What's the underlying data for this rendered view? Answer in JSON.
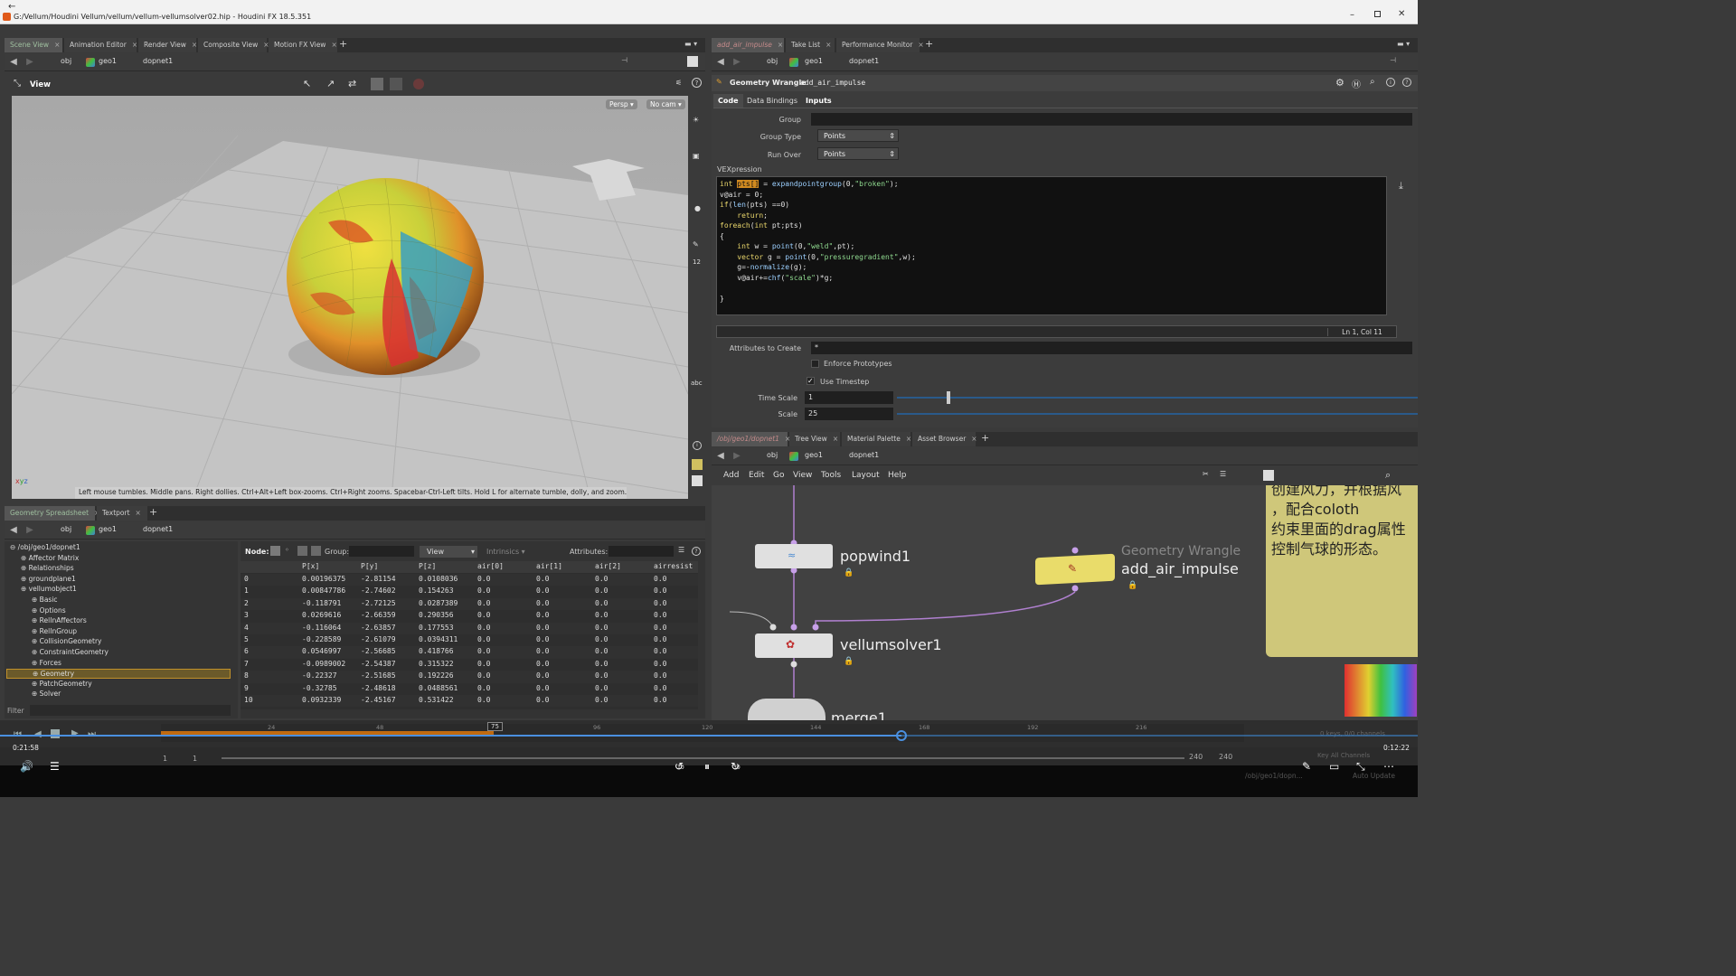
{
  "window": {
    "title": "G:/Vellum/Houdini Vellum/vellum/vellum-vellumsolver02.hip - Houdini FX 18.5.351"
  },
  "left_tabs": [
    {
      "label": "Scene View",
      "active": true
    },
    {
      "label": "Animation Editor"
    },
    {
      "label": "Render View"
    },
    {
      "label": "Composite View"
    },
    {
      "label": "Motion FX View"
    }
  ],
  "right_tabs": [
    {
      "label": "add_air_impulse",
      "active": true
    },
    {
      "label": "Take List"
    },
    {
      "label": "Performance Monitor"
    }
  ],
  "path": {
    "obj": "obj",
    "geo": "geo1",
    "dop": "dopnet1"
  },
  "viewport": {
    "title": "View",
    "persp_label": "Persp",
    "cam_label": "No cam",
    "hint": "Left mouse tumbles. Middle pans. Right dollies. Ctrl+Alt+Left box-zooms. Ctrl+Right zooms. Spacebar-Ctrl-Left tilts. Hold L for alternate tumble, dolly, and zoom."
  },
  "param": {
    "node_type": "Geometry Wrangle",
    "node_name": "add_air_impulse",
    "tabs": [
      "Code",
      "Data Bindings",
      "Inputs"
    ],
    "group_label": "Group",
    "group_type_label": "Group Type",
    "group_type_value": "Points",
    "run_over_label": "Run Over",
    "run_over_value": "Points",
    "vex_label": "VEXpression",
    "cursor_pos": "Ln 1, Col 11",
    "attrs_label": "Attributes to Create",
    "attrs_value": "*",
    "enforce_label": "Enforce Prototypes",
    "use_timestep_label": "Use Timestep",
    "time_scale_label": "Time Scale",
    "time_scale_value": "1",
    "scale_label": "Scale",
    "scale_value": "25"
  },
  "vex_lines": [
    "int pts[] = expandpointgroup(0,\"broken\");",
    "v@air = 0;",
    "if(len(pts) ==0)",
    "    return;",
    "foreach(int pt;pts)",
    "{",
    "    int w = point(0,\"weld\",pt);",
    "    vector g = point(0,\"pressuregradient\",w);",
    "    g=-normalize(g);",
    "    v@air+=chf(\"scale\")*g;",
    "",
    "}"
  ],
  "network_tabs": [
    {
      "label": "/obj/geo1/dopnet1",
      "active": true
    },
    {
      "label": "Tree View"
    },
    {
      "label": "Material Palette"
    },
    {
      "label": "Asset Browser"
    }
  ],
  "network_menu": [
    "Add",
    "Edit",
    "Go",
    "View",
    "Tools",
    "Layout",
    "Help"
  ],
  "nodes": {
    "popwind": "popwind1",
    "vellumsolver": "vellumsolver1",
    "wrangle_type": "Geometry Wrangle",
    "wrangle_name": "add_air_impulse",
    "merge": "merge1"
  },
  "sticky_note": [
    "创建风力，并根据风",
    "，配合coloth",
    "约束里面的drag属性",
    "控制气球的形态。"
  ],
  "spreadsheet": {
    "tabs": [
      {
        "label": "Geometry Spreadsheet",
        "active": true
      },
      {
        "label": "Textport"
      }
    ],
    "node_label": "Node:",
    "group_label": "Group:",
    "view_label": "View",
    "intrinsics_label": "Intrinsics",
    "attributes_label": "Attributes:",
    "filter_label": "Filter",
    "columns": [
      "",
      "P[x]",
      "P[y]",
      "P[z]",
      "air[0]",
      "air[1]",
      "air[2]",
      "airresist"
    ],
    "rows": [
      [
        "0",
        "0.00196375",
        "-2.81154",
        "0.0108036",
        "0.0",
        "0.0",
        "0.0",
        "0.0"
      ],
      [
        "1",
        "0.00847786",
        "-2.74602",
        "0.154263",
        "0.0",
        "0.0",
        "0.0",
        "0.0"
      ],
      [
        "2",
        "-0.118791",
        "-2.72125",
        "0.0287389",
        "0.0",
        "0.0",
        "0.0",
        "0.0"
      ],
      [
        "3",
        "0.0269616",
        "-2.66359",
        "0.290356",
        "0.0",
        "0.0",
        "0.0",
        "0.0"
      ],
      [
        "4",
        "-0.116064",
        "-2.63857",
        "0.177553",
        "0.0",
        "0.0",
        "0.0",
        "0.0"
      ],
      [
        "5",
        "-0.228589",
        "-2.61079",
        "0.0394311",
        "0.0",
        "0.0",
        "0.0",
        "0.0"
      ],
      [
        "6",
        "0.0546997",
        "-2.56685",
        "0.418766",
        "0.0",
        "0.0",
        "0.0",
        "0.0"
      ],
      [
        "7",
        "-0.0989002",
        "-2.54387",
        "0.315322",
        "0.0",
        "0.0",
        "0.0",
        "0.0"
      ],
      [
        "8",
        "-0.22327",
        "-2.51685",
        "0.192226",
        "0.0",
        "0.0",
        "0.0",
        "0.0"
      ],
      [
        "9",
        "-0.32785",
        "-2.48618",
        "0.0488561",
        "0.0",
        "0.0",
        "0.0",
        "0.0"
      ],
      [
        "10",
        "0.0932339",
        "-2.45167",
        "0.531422",
        "0.0",
        "0.0",
        "0.0",
        "0.0"
      ]
    ]
  },
  "tree": [
    {
      "label": "/obj/geo1/dopnet1",
      "depth": 0
    },
    {
      "label": "Affector Matrix",
      "depth": 1
    },
    {
      "label": "Relationships",
      "depth": 1
    },
    {
      "label": "groundplane1",
      "depth": 1
    },
    {
      "label": "vellumobject1",
      "depth": 1
    },
    {
      "label": "Basic",
      "depth": 2
    },
    {
      "label": "Options",
      "depth": 2
    },
    {
      "label": "RelInAffectors",
      "depth": 2
    },
    {
      "label": "RelInGroup",
      "depth": 2
    },
    {
      "label": "CollisionGeometry",
      "depth": 2
    },
    {
      "label": "ConstraintGeometry",
      "depth": 2
    },
    {
      "label": "Forces",
      "depth": 2
    },
    {
      "label": "Geometry",
      "depth": 2,
      "selected": true
    },
    {
      "label": "PatchGeometry",
      "depth": 2
    },
    {
      "label": "Solver",
      "depth": 2
    }
  ],
  "timeline": {
    "ticks": [
      "24",
      "48",
      "96",
      "120",
      "144",
      "168",
      "192",
      "216"
    ],
    "current_frame": "75",
    "start1": "1",
    "start2": "1",
    "end1": "240",
    "end2": "240",
    "keys": "0 keys, 0/0 channels",
    "key_all": "Key All Channels",
    "auto_update": "Auto Update",
    "status_path": "/obj/geo1/dopn..."
  },
  "player": {
    "elapsed": "0:21:58",
    "remaining": "0:12:22",
    "rewind": "10",
    "forward": "30"
  },
  "colors": {
    "accent": "#f0a030",
    "node_selected": "#e9dc6a",
    "sticky": "#cfc77a"
  }
}
